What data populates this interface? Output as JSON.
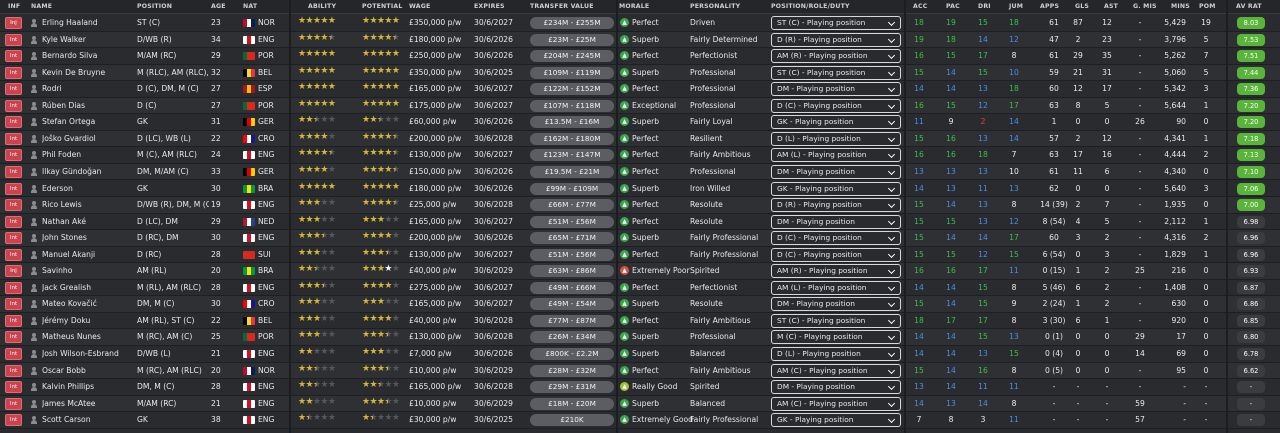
{
  "headers": {
    "inf": "INF",
    "name": "NAME",
    "position": "POSITION",
    "age": "AGE",
    "nat": "NAT",
    "ability": "ABILITY",
    "potential": "POTENTIAL",
    "wage": "WAGE",
    "expires": "EXPIRES",
    "transfer_value": "TRANSFER VALUE",
    "morale": "MORALE",
    "personality": "PERSONALITY",
    "role": "POSITION/ROLE/DUTY",
    "acc": "ACC",
    "pac": "PAC",
    "dri": "DRI",
    "jum": "JUM",
    "apps": "APPS",
    "gls": "GLS",
    "ast": "AST",
    "gmis": "G. MIS",
    "mins": "MINS",
    "pom": "POM",
    "avrat": "AV RAT"
  },
  "colors": {
    "avrat_green": "#59b53a",
    "avrat_dark": "#3b3c40",
    "stat_green": "#3ebd4c",
    "stat_blue": "#4a8fe0",
    "stat_red": "#d9443b"
  },
  "players": [
    {
      "inf": "Inj",
      "name": "Erling Haaland",
      "pos": "ST (C)",
      "age": "23",
      "nat": "NOR",
      "flag": [
        "#ba0c2f",
        "#ffffff",
        "#00205b"
      ],
      "ab": 5,
      "pot": 5,
      "wage": "£350,000 p/w",
      "exp": "30/6/2027",
      "tv": "£234M - £255M",
      "morale": "Perfect",
      "mood": "good",
      "pers": "Driven",
      "role": "ST (C) - Playing position",
      "acc": "18",
      "pac": "19",
      "dri": "15",
      "jum": "18",
      "apps": "61",
      "gls": "87",
      "ast": "12",
      "gmis": "-",
      "mins": "5,429",
      "pom": "19",
      "avr": "8.03",
      "sc": [
        "green",
        "green",
        "green",
        "green"
      ]
    },
    {
      "inf": "Int",
      "name": "Kyle Walker",
      "pos": "D/WB (R)",
      "age": "34",
      "nat": "ENG",
      "flag": [
        "#ffffff",
        "#ce1124",
        "#ffffff"
      ],
      "ab": 4.5,
      "pot": 4.5,
      "wage": "£180,000 p/w",
      "exp": "30/6/2026",
      "tv": "£23M - £25M",
      "morale": "Superb",
      "mood": "good",
      "pers": "Fairly Determined",
      "role": "D (R) - Playing position",
      "acc": "19",
      "pac": "18",
      "dri": "14",
      "jum": "12",
      "apps": "47",
      "gls": "2",
      "ast": "23",
      "gmis": "-",
      "mins": "3,796",
      "pom": "5",
      "avr": "7.53",
      "sc": [
        "green",
        "green",
        "blue",
        "blue"
      ]
    },
    {
      "inf": "Int",
      "name": "Bernardo Silva",
      "pos": "M/AM (RC)",
      "age": "29",
      "nat": "POR",
      "flag": [
        "#046a38",
        "#da291c",
        "#da291c"
      ],
      "ab": 5,
      "pot": 5,
      "wage": "£250,000 p/w",
      "exp": "30/6/2026",
      "tv": "£204M - £245M",
      "morale": "Perfect",
      "mood": "good",
      "pers": "Perfectionist",
      "role": "AM (R) - Playing position",
      "acc": "16",
      "pac": "15",
      "dri": "17",
      "jum": "8",
      "apps": "61",
      "gls": "29",
      "ast": "35",
      "gmis": "-",
      "mins": "5,262",
      "pom": "7",
      "avr": "7.51",
      "sc": [
        "green",
        "green",
        "green",
        "white"
      ]
    },
    {
      "inf": "Int",
      "name": "Kevin De Bruyne",
      "pos": "M (RLC), AM (RLC), ST...",
      "age": "32",
      "nat": "BEL",
      "flag": [
        "#000000",
        "#fdda24",
        "#ef3340"
      ],
      "ab": 5,
      "pot": 5,
      "wage": "£350,000 p/w",
      "exp": "30/6/2025",
      "tv": "£109M - £119M",
      "morale": "Superb",
      "mood": "good",
      "pers": "Professional",
      "role": "ST (C) - Playing position",
      "acc": "15",
      "pac": "14",
      "dri": "15",
      "jum": "10",
      "apps": "59",
      "gls": "21",
      "ast": "31",
      "gmis": "-",
      "mins": "5,060",
      "pom": "5",
      "avr": "7.44",
      "sc": [
        "green",
        "blue",
        "green",
        "blue"
      ]
    },
    {
      "inf": "Int",
      "name": "Rodri",
      "pos": "D (C), DM, M (C)",
      "age": "27",
      "nat": "ESP",
      "flag": [
        "#aa151b",
        "#f1bf00",
        "#aa151b"
      ],
      "ab": 5,
      "pot": 5,
      "wage": "£165,000 p/w",
      "exp": "30/6/2027",
      "tv": "£122M - £152M",
      "morale": "Perfect",
      "mood": "good",
      "pers": "Professional",
      "role": "DM - Playing position",
      "acc": "14",
      "pac": "14",
      "dri": "13",
      "jum": "18",
      "apps": "60",
      "gls": "12",
      "ast": "17",
      "gmis": "-",
      "mins": "5,342",
      "pom": "3",
      "avr": "7.36",
      "sc": [
        "blue",
        "blue",
        "blue",
        "green"
      ]
    },
    {
      "inf": "Int",
      "name": "Rúben Dias",
      "pos": "D (C)",
      "age": "27",
      "nat": "POR",
      "flag": [
        "#046a38",
        "#da291c",
        "#da291c"
      ],
      "ab": 5,
      "pot": 5,
      "wage": "£175,000 p/w",
      "exp": "30/6/2027",
      "tv": "£107M - £118M",
      "morale": "Exceptional",
      "mood": "good",
      "pers": "Professional",
      "role": "D (C) - Playing position",
      "acc": "16",
      "pac": "15",
      "dri": "12",
      "jum": "17",
      "apps": "63",
      "gls": "8",
      "ast": "5",
      "gmis": "-",
      "mins": "5,644",
      "pom": "1",
      "avr": "7.20",
      "sc": [
        "green",
        "green",
        "blue",
        "green"
      ]
    },
    {
      "inf": "Int",
      "name": "Stefan Ortega",
      "pos": "GK",
      "age": "31",
      "nat": "GER",
      "flag": [
        "#000000",
        "#dd0000",
        "#ffce00"
      ],
      "ab": 2.5,
      "pot": 2.5,
      "wage": "£60,000 p/w",
      "exp": "30/6/2026",
      "tv": "£13.5M - £16M",
      "morale": "Superb",
      "mood": "good",
      "pers": "Fairly Loyal",
      "role": "GK - Playing position",
      "acc": "11",
      "pac": "9",
      "dri": "2",
      "jum": "14",
      "apps": "1",
      "gls": "0",
      "ast": "0",
      "gmis": "26",
      "mins": "90",
      "pom": "0",
      "avr": "7.20",
      "sc": [
        "blue",
        "white",
        "red",
        "blue"
      ]
    },
    {
      "inf": "Int",
      "name": "Joško Gvardiol",
      "pos": "D (LC), WB (L)",
      "age": "22",
      "nat": "CRO",
      "flag": [
        "#ff0000",
        "#ffffff",
        "#171796"
      ],
      "ab": 4,
      "pot": 4.5,
      "wage": "£200,000 p/w",
      "exp": "30/6/2028",
      "tv": "£162M - £180M",
      "morale": "Perfect",
      "mood": "good",
      "pers": "Resilient",
      "role": "D (L) - Playing position",
      "acc": "15",
      "pac": "16",
      "dri": "13",
      "jum": "14",
      "apps": "57",
      "gls": "2",
      "ast": "12",
      "gmis": "-",
      "mins": "4,341",
      "pom": "1",
      "avr": "7.18",
      "sc": [
        "green",
        "green",
        "blue",
        "blue"
      ]
    },
    {
      "inf": "Int",
      "name": "Phil Foden",
      "pos": "M (C), AM (RLC)",
      "age": "24",
      "nat": "ENG",
      "flag": [
        "#ffffff",
        "#ce1124",
        "#ffffff"
      ],
      "ab": 4.5,
      "pot": 4.5,
      "wage": "£130,000 p/w",
      "exp": "30/6/2027",
      "tv": "£123M - £147M",
      "morale": "Perfect",
      "mood": "good",
      "pers": "Fairly Ambitious",
      "role": "AM (L) - Playing position",
      "acc": "16",
      "pac": "16",
      "dri": "18",
      "jum": "7",
      "apps": "63",
      "gls": "17",
      "ast": "16",
      "gmis": "-",
      "mins": "4,444",
      "pom": "2",
      "avr": "7.13",
      "sc": [
        "green",
        "green",
        "green",
        "white"
      ]
    },
    {
      "inf": "Int",
      "name": "Ilkay Gündoğan",
      "pos": "DM, M/AM (C)",
      "age": "33",
      "nat": "GER",
      "flag": [
        "#000000",
        "#dd0000",
        "#ffce00"
      ],
      "ab": 4,
      "pot": 4.5,
      "wage": "£150,000 p/w",
      "exp": "30/6/2026",
      "tv": "£19.5M - £21M",
      "morale": "Perfect",
      "mood": "good",
      "pers": "Professional",
      "role": "DM - Playing position",
      "acc": "13",
      "pac": "13",
      "dri": "13",
      "jum": "10",
      "apps": "61",
      "gls": "11",
      "ast": "6",
      "gmis": "-",
      "mins": "4,340",
      "pom": "0",
      "avr": "7.10",
      "sc": [
        "blue",
        "blue",
        "blue",
        "white"
      ]
    },
    {
      "inf": "Int",
      "name": "Ederson",
      "pos": "GK",
      "age": "30",
      "nat": "BRA",
      "flag": [
        "#009c3b",
        "#ffdf00",
        "#009c3b"
      ],
      "ab": 5,
      "pot": 5,
      "wage": "£180,000 p/w",
      "exp": "30/6/2026",
      "tv": "£99M - £109M",
      "morale": "Superb",
      "mood": "good",
      "pers": "Iron Willed",
      "role": "GK - Playing position",
      "acc": "14",
      "pac": "13",
      "dri": "11",
      "jum": "13",
      "apps": "62",
      "gls": "0",
      "ast": "0",
      "gmis": "-",
      "mins": "5,640",
      "pom": "3",
      "avr": "7.06",
      "sc": [
        "blue",
        "blue",
        "blue",
        "blue"
      ]
    },
    {
      "inf": "Int",
      "name": "Rico Lewis",
      "pos": "D/WB (R), DM, M (C)",
      "age": "19",
      "nat": "ENG",
      "flag": [
        "#ffffff",
        "#ce1124",
        "#ffffff"
      ],
      "ab": 3,
      "pot": 4.5,
      "wage": "£25,000 p/w",
      "exp": "30/6/2028",
      "tv": "£66M - £77M",
      "morale": "Perfect",
      "mood": "good",
      "pers": "Resolute",
      "role": "D (R) - Playing position",
      "acc": "15",
      "pac": "14",
      "dri": "13",
      "jum": "8",
      "apps": "14 (39)",
      "gls": "2",
      "ast": "7",
      "gmis": "-",
      "mins": "1,935",
      "pom": "0",
      "avr": "7.00",
      "sc": [
        "green",
        "blue",
        "blue",
        "white"
      ]
    },
    {
      "inf": "Int",
      "name": "Nathan Aké",
      "pos": "D (LC), DM",
      "age": "29",
      "nat": "NED",
      "flag": [
        "#ae1c28",
        "#ffffff",
        "#21468b"
      ],
      "ab": 3,
      "pot": 3,
      "wage": "£165,000 p/w",
      "exp": "30/6/2027",
      "tv": "£51M - £56M",
      "morale": "Perfect",
      "mood": "good",
      "pers": "Resolute",
      "role": "DM - Playing position",
      "acc": "15",
      "pac": "15",
      "dri": "13",
      "jum": "12",
      "apps": "8 (54)",
      "gls": "4",
      "ast": "5",
      "gmis": "-",
      "mins": "2,112",
      "pom": "1",
      "avr": "6.98",
      "sc": [
        "green",
        "green",
        "blue",
        "blue"
      ]
    },
    {
      "inf": "Int",
      "name": "John Stones",
      "pos": "D (RC), DM",
      "age": "30",
      "nat": "ENG",
      "flag": [
        "#ffffff",
        "#ce1124",
        "#ffffff"
      ],
      "ab": 3.5,
      "pot": 4,
      "wage": "£200,000 p/w",
      "exp": "30/6/2026",
      "tv": "£65M - £71M",
      "morale": "Superb",
      "mood": "good",
      "pers": "Fairly Professional",
      "role": "D (C) - Playing position",
      "acc": "15",
      "pac": "14",
      "dri": "14",
      "jum": "17",
      "apps": "60",
      "gls": "3",
      "ast": "2",
      "gmis": "-",
      "mins": "4,316",
      "pom": "2",
      "avr": "6.96",
      "sc": [
        "green",
        "blue",
        "blue",
        "green"
      ]
    },
    {
      "inf": "Int",
      "name": "Manuel Akanji",
      "pos": "D (RC)",
      "age": "28",
      "nat": "SUI",
      "flag": [
        "#d52b1e",
        "#d52b1e",
        "#d52b1e"
      ],
      "ab": 3,
      "pot": 3.5,
      "wage": "£130,000 p/w",
      "exp": "30/6/2027",
      "tv": "£51M - £56M",
      "morale": "Perfect",
      "mood": "good",
      "pers": "Fairly Professional",
      "role": "D (C) - Playing position",
      "acc": "15",
      "pac": "15",
      "dri": "12",
      "jum": "15",
      "apps": "6 (54)",
      "gls": "0",
      "ast": "3",
      "gmis": "-",
      "mins": "1,829",
      "pom": "1",
      "avr": "6.96",
      "sc": [
        "green",
        "green",
        "blue",
        "green"
      ]
    },
    {
      "inf": "Inj",
      "name": "Savinho",
      "pos": "AM (RL)",
      "age": "20",
      "nat": "BRA",
      "flag": [
        "#009c3b",
        "#ffdf00",
        "#009c3b"
      ],
      "ab": 2.5,
      "pot": 4,
      "potw": true,
      "wage": "£40,000 p/w",
      "exp": "30/6/2029",
      "tv": "£63M - £86M",
      "morale": "Extremely Poor",
      "mood": "poor",
      "pers": "Spirited",
      "role": "AM (R) - Playing position",
      "acc": "16",
      "pac": "16",
      "dri": "17",
      "jum": "11",
      "apps": "0 (15)",
      "gls": "1",
      "ast": "2",
      "gmis": "25",
      "mins": "216",
      "pom": "0",
      "avr": "6.93",
      "sc": [
        "green",
        "green",
        "green",
        "blue"
      ]
    },
    {
      "inf": "Int",
      "name": "Jack Grealish",
      "pos": "M (RL), AM (RLC)",
      "age": "28",
      "nat": "ENG",
      "flag": [
        "#ffffff",
        "#ce1124",
        "#ffffff"
      ],
      "ab": 3.5,
      "pot": 4,
      "wage": "£275,000 p/w",
      "exp": "30/6/2027",
      "tv": "£49M - £66M",
      "morale": "Perfect",
      "mood": "good",
      "pers": "Perfectionist",
      "role": "AM (L) - Playing position",
      "acc": "14",
      "pac": "14",
      "dri": "15",
      "jum": "8",
      "apps": "5 (46)",
      "gls": "6",
      "ast": "2",
      "gmis": "-",
      "mins": "1,408",
      "pom": "0",
      "avr": "6.87",
      "sc": [
        "blue",
        "blue",
        "green",
        "white"
      ]
    },
    {
      "inf": "Int",
      "name": "Mateo Kovačić",
      "pos": "DM, M (C)",
      "age": "30",
      "nat": "CRO",
      "flag": [
        "#ff0000",
        "#ffffff",
        "#171796"
      ],
      "ab": 3,
      "pot": 3,
      "wage": "£165,000 p/w",
      "exp": "30/6/2027",
      "tv": "£49M - £54M",
      "morale": "Superb",
      "mood": "good",
      "pers": "Resolute",
      "role": "DM - Playing position",
      "acc": "15",
      "pac": "14",
      "dri": "15",
      "jum": "9",
      "apps": "2 (24)",
      "gls": "1",
      "ast": "2",
      "gmis": "-",
      "mins": "630",
      "pom": "0",
      "avr": "6.86",
      "sc": [
        "green",
        "blue",
        "green",
        "white"
      ]
    },
    {
      "inf": "Int",
      "name": "Jérémy Doku",
      "pos": "AM (RL), ST (C)",
      "age": "22",
      "nat": "BEL",
      "flag": [
        "#000000",
        "#fdda24",
        "#ef3340"
      ],
      "ab": 3,
      "pot": 4,
      "wage": "£40,000 p/w",
      "exp": "30/6/2028",
      "tv": "£77M - £87M",
      "morale": "Perfect",
      "mood": "good",
      "pers": "Fairly Ambitious",
      "role": "ST (C) - Playing position",
      "acc": "18",
      "pac": "17",
      "dri": "17",
      "jum": "8",
      "apps": "3 (30)",
      "gls": "6",
      "ast": "1",
      "gmis": "-",
      "mins": "920",
      "pom": "0",
      "avr": "6.85",
      "sc": [
        "green",
        "green",
        "green",
        "white"
      ]
    },
    {
      "inf": "Int",
      "name": "Matheus Nunes",
      "pos": "M (RC), AM (C)",
      "age": "25",
      "nat": "POR",
      "flag": [
        "#046a38",
        "#da291c",
        "#da291c"
      ],
      "ab": 3,
      "pot": 3.5,
      "wage": "£130,000 p/w",
      "exp": "30/6/2028",
      "tv": "£26M - £34M",
      "morale": "Superb",
      "mood": "good",
      "pers": "Professional",
      "role": "M (C) - Playing position",
      "acc": "14",
      "pac": "14",
      "dri": "15",
      "jum": "13",
      "apps": "0 (1)",
      "gls": "0",
      "ast": "0",
      "gmis": "29",
      "mins": "17",
      "pom": "0",
      "avr": "6.80",
      "sc": [
        "blue",
        "blue",
        "green",
        "blue"
      ]
    },
    {
      "inf": "Int",
      "name": "Josh Wilson-Esbrand",
      "pos": "D/WB (L)",
      "age": "21",
      "nat": "ENG",
      "flag": [
        "#ffffff",
        "#ce1124",
        "#ffffff"
      ],
      "ab": 2,
      "pot": 3,
      "wage": "£7,000 p/w",
      "exp": "30/6/2026",
      "tv": "£800K - £2.2M",
      "morale": "Superb",
      "mood": "good",
      "pers": "Balanced",
      "role": "D (L) - Playing position",
      "acc": "14",
      "pac": "14",
      "dri": "13",
      "jum": "15",
      "apps": "0 (4)",
      "gls": "0",
      "ast": "0",
      "gmis": "14",
      "mins": "69",
      "pom": "0",
      "avr": "6.78",
      "sc": [
        "blue",
        "blue",
        "blue",
        "green"
      ]
    },
    {
      "inf": "Int",
      "name": "Oscar Bobb",
      "pos": "M (RC), AM (RLC)",
      "age": "20",
      "nat": "NOR",
      "flag": [
        "#ba0c2f",
        "#ffffff",
        "#00205b"
      ],
      "ab": 2.5,
      "pot": 3.5,
      "wage": "£10,000 p/w",
      "exp": "30/6/2029",
      "tv": "£28M - £32M",
      "morale": "Perfect",
      "mood": "good",
      "pers": "Fairly Ambitious",
      "role": "AM (C) - Playing position",
      "acc": "15",
      "pac": "14",
      "dri": "16",
      "jum": "8",
      "apps": "0 (5)",
      "gls": "0",
      "ast": "0",
      "gmis": "-",
      "mins": "95",
      "pom": "0",
      "avr": "6.62",
      "sc": [
        "green",
        "blue",
        "green",
        "white"
      ]
    },
    {
      "inf": "Int",
      "name": "Kalvin Phillips",
      "pos": "DM, M (C)",
      "age": "28",
      "nat": "ENG",
      "flag": [
        "#ffffff",
        "#ce1124",
        "#ffffff"
      ],
      "ab": 2.5,
      "pot": 2.5,
      "wage": "£165,000 p/w",
      "exp": "30/6/2028",
      "tv": "£29M - £31M",
      "morale": "Really Good",
      "mood": "rg",
      "pers": "Spirited",
      "role": "DM - Playing position",
      "acc": "13",
      "pac": "14",
      "dri": "11",
      "jum": "11",
      "apps": "-",
      "gls": "-",
      "ast": "-",
      "gmis": "-",
      "mins": "-",
      "pom": "-",
      "avr": "-",
      "sc": [
        "blue",
        "blue",
        "blue",
        "blue"
      ]
    },
    {
      "inf": "Int",
      "name": "James McAtee",
      "pos": "M/AM (RC)",
      "age": "21",
      "nat": "ENG",
      "flag": [
        "#ffffff",
        "#ce1124",
        "#ffffff"
      ],
      "ab": 2,
      "pot": 3.5,
      "wage": "£10,000 p/w",
      "exp": "30/6/2029",
      "tv": "£18M - £20M",
      "morale": "Superb",
      "mood": "good",
      "pers": "Balanced",
      "role": "AM (C) - Playing position",
      "acc": "14",
      "pac": "13",
      "dri": "14",
      "jum": "8",
      "apps": "-",
      "gls": "-",
      "ast": "-",
      "gmis": "59",
      "mins": "-",
      "pom": "-",
      "avr": "-",
      "sc": [
        "blue",
        "blue",
        "blue",
        "white"
      ]
    },
    {
      "inf": "Int",
      "name": "Scott Carson",
      "pos": "GK",
      "age": "38",
      "nat": "ENG",
      "flag": [
        "#ffffff",
        "#ce1124",
        "#ffffff"
      ],
      "ab": 1.5,
      "pot": 1.5,
      "wage": "£30,000 p/w",
      "exp": "30/6/2025",
      "tv": "£210K",
      "morale": "Extremely Good",
      "mood": "good",
      "pers": "Fairly Professional",
      "role": "GK - Playing position",
      "acc": "7",
      "pac": "8",
      "dri": "3",
      "jum": "11",
      "apps": "-",
      "gls": "-",
      "ast": "-",
      "gmis": "57",
      "mins": "-",
      "pom": "-",
      "avr": "-",
      "sc": [
        "white",
        "white",
        "white",
        "blue"
      ]
    }
  ]
}
